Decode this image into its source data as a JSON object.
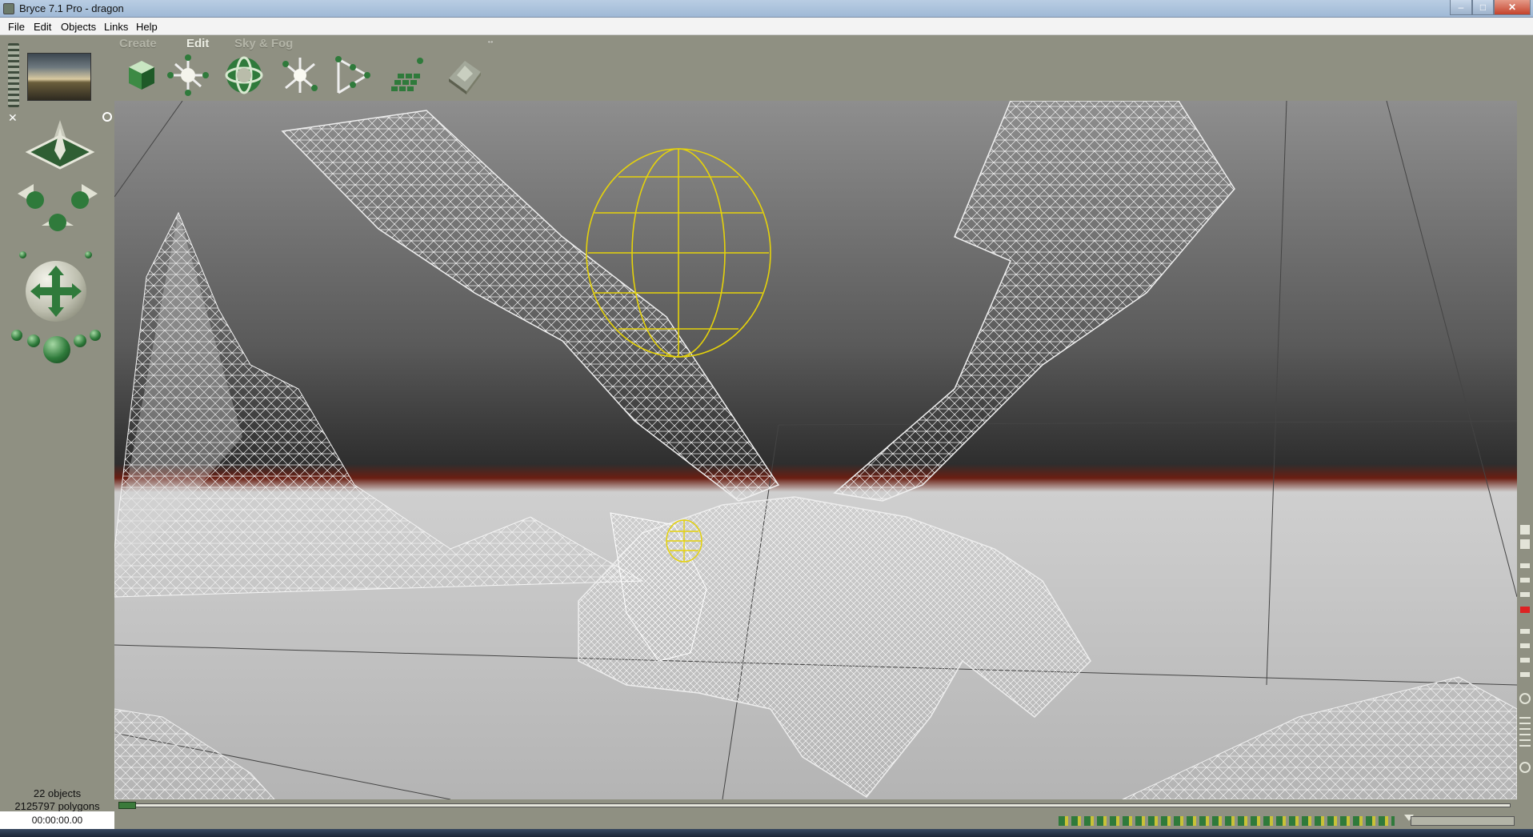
{
  "window": {
    "title": "Bryce 7.1  Pro - dragon",
    "minimize_glyph": "–",
    "maximize_glyph": "□",
    "close_glyph": "✕"
  },
  "menu": {
    "items": [
      "File",
      "Edit",
      "Objects",
      "Links",
      "Help"
    ]
  },
  "palette_tabs": [
    "Create",
    "Edit",
    "Sky & Fog"
  ],
  "active_tab": "Edit",
  "toolbar": {
    "tools": [
      {
        "name": "resize-tool",
        "icon": "cube-resize-icon"
      },
      {
        "name": "rotate-tool",
        "icon": "rotate-icon"
      },
      {
        "name": "reposition-tool",
        "icon": "reposition-icon"
      },
      {
        "name": "align-tool",
        "icon": "align-icon"
      },
      {
        "name": "randomize-tool",
        "icon": "randomize-icon"
      },
      {
        "name": "replicate-tool",
        "icon": "replicate-icon"
      },
      {
        "name": "terrain-editor-tool",
        "icon": "terrain-icon"
      }
    ]
  },
  "status": {
    "objects": "22 objects",
    "polygons": "2125797 polygons",
    "time": "00:00:00.00"
  },
  "colors": {
    "palette_bg": "#8f9082",
    "accent_green": "#2e7a3a",
    "selection_yellow": "#e5d20a",
    "wireframe": "#ffffff"
  }
}
